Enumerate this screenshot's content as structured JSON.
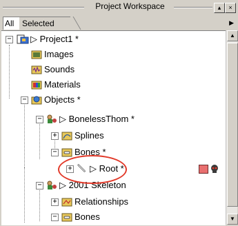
{
  "window": {
    "title": "Project Workspace",
    "minimize_glyph": "▴",
    "close_glyph": "×"
  },
  "tabs": {
    "all": "All",
    "selected": "Selected",
    "arrow": "▶"
  },
  "tree": {
    "project": "▷ Project1 *",
    "images": "Images",
    "sounds": "Sounds",
    "materials": "Materials",
    "objects": "Objects *",
    "boneless": "▷ BonelessThom *",
    "splines": "Splines",
    "bones": "Bones *",
    "root": "▷ Root *",
    "skeleton": "▷ 2001 Skeleton",
    "relationships": "Relationships",
    "bones2": "Bones"
  },
  "glyphs": {
    "minus": "−",
    "plus": "+",
    "scroll_up": "▲",
    "scroll_down": "▼"
  },
  "colors": {
    "highlight_oval": "#e23a2a",
    "root_swatch": "#e86f6f"
  }
}
